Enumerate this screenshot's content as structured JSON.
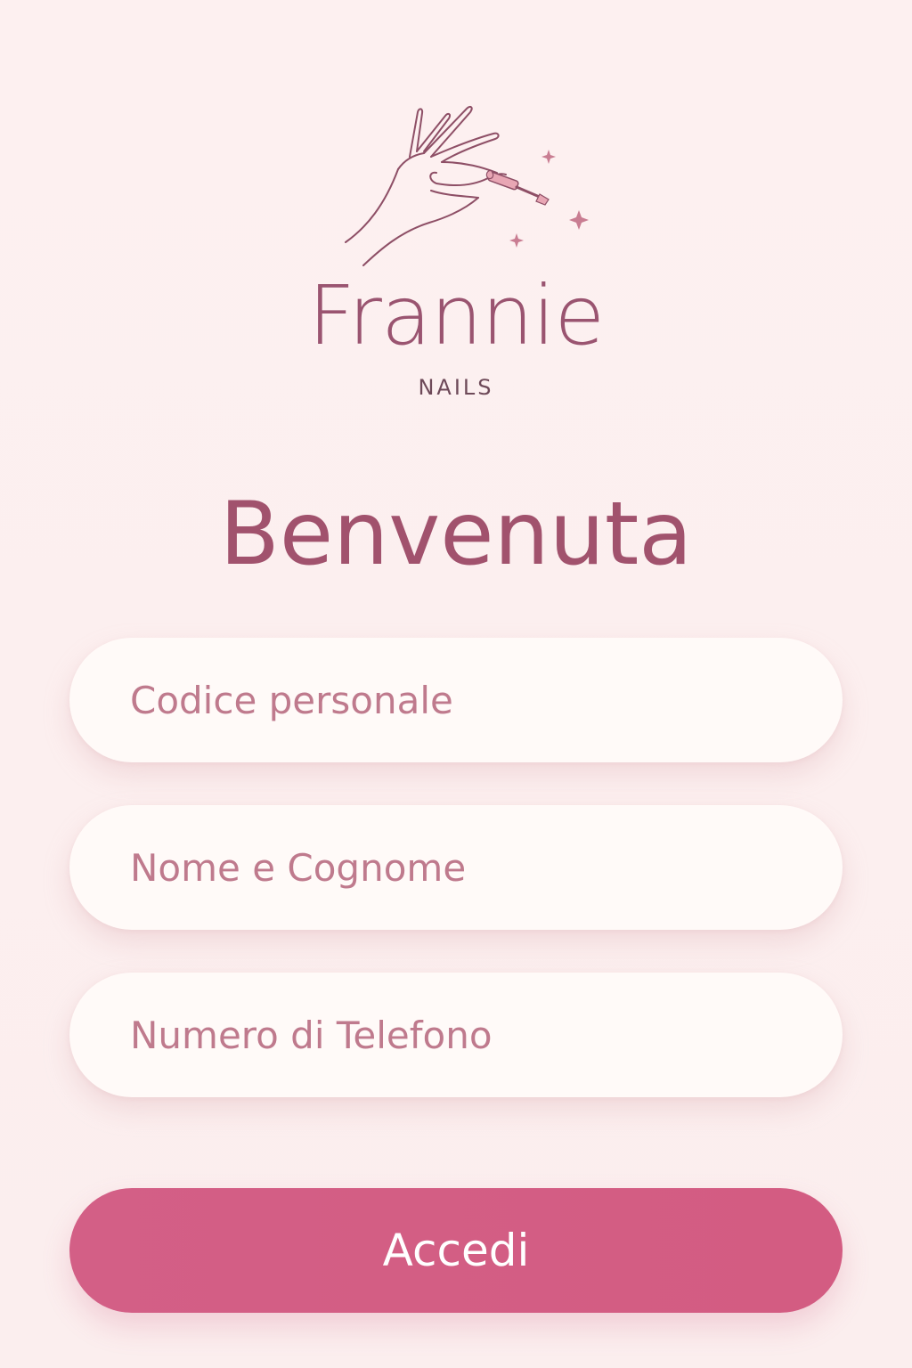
{
  "brand": {
    "name": "Frannie",
    "subtitle": "NAILS",
    "logo_icon": "hand-nail-polish-icon"
  },
  "welcome": {
    "title": "Benvenuta"
  },
  "form": {
    "fields": [
      {
        "placeholder": "Codice personale",
        "value": ""
      },
      {
        "placeholder": "Nome e Cognome",
        "value": ""
      },
      {
        "placeholder": "Numero di Telefono",
        "value": ""
      }
    ],
    "submit_label": "Accedi"
  },
  "colors": {
    "background": "#fcefef",
    "brand": "#9a5470",
    "accent": "#d35f86",
    "field_background": "#fffaf8",
    "placeholder": "#bf7a8d"
  }
}
